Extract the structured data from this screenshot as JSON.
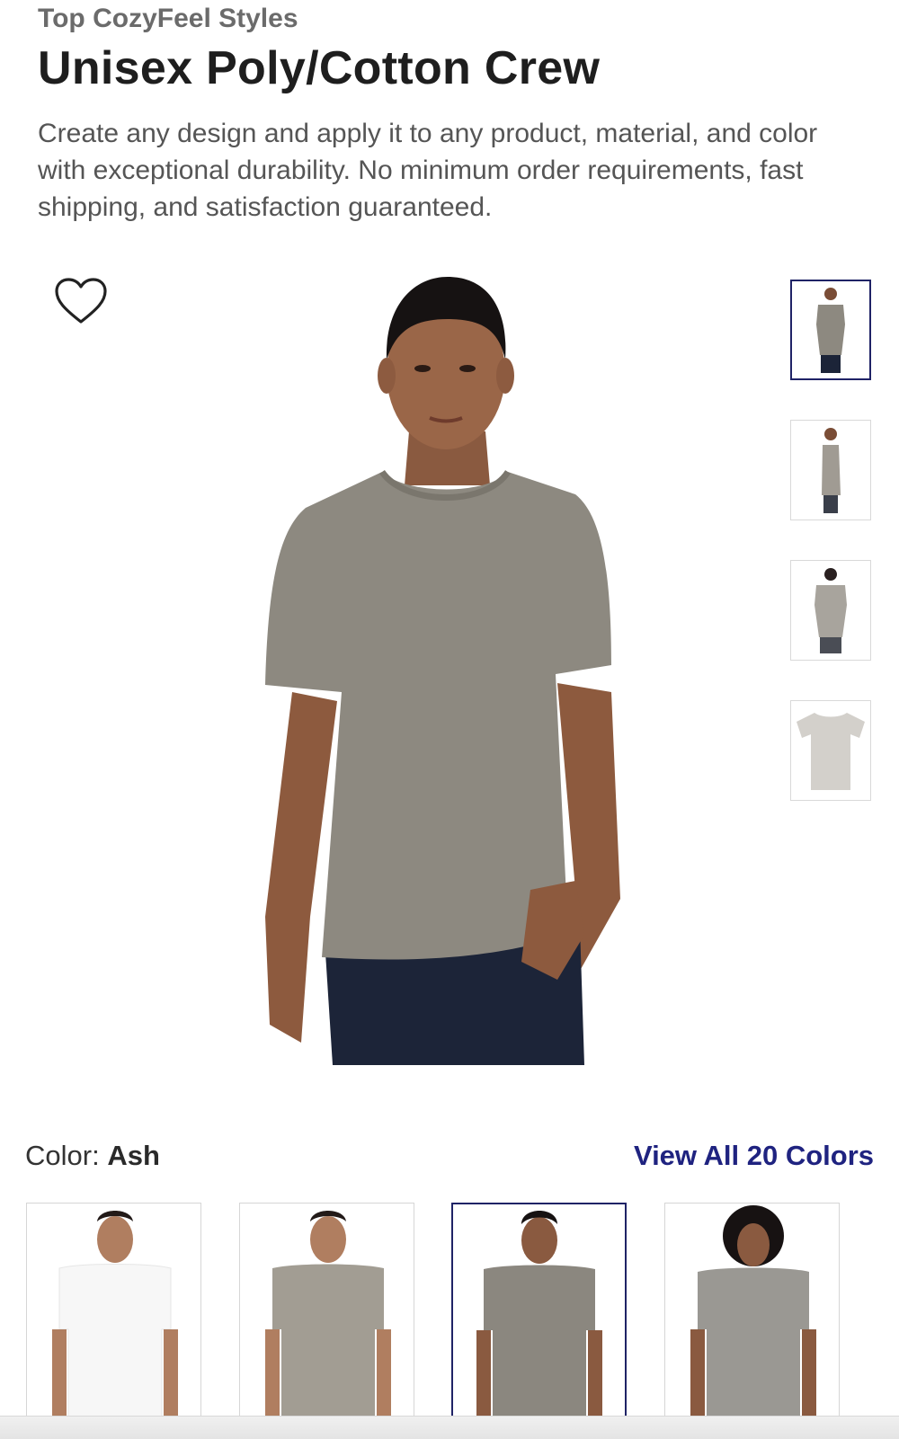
{
  "header": {
    "eyebrow": "Top CozyFeel Styles",
    "title": "Unisex Poly/Cotton Crew",
    "description": "Create any design and apply it to any product, material, and color with exceptional durability. No minimum order requirements, fast shipping, and satisfaction guaranteed."
  },
  "favorite": {
    "icon": "heart-outline-icon"
  },
  "gallery": {
    "main_view": "front",
    "thumbnails": [
      {
        "view": "front",
        "active": true
      },
      {
        "view": "side",
        "active": false
      },
      {
        "view": "back",
        "active": false
      },
      {
        "view": "flat",
        "active": false
      }
    ]
  },
  "color": {
    "label": "Color:",
    "selected": "Ash",
    "view_all": "View All 20 Colors",
    "swatches": [
      {
        "shirt_color": "#f7f7f7",
        "active": false
      },
      {
        "shirt_color": "#a29d93",
        "active": false
      },
      {
        "shirt_color": "#8b877f",
        "active": true
      },
      {
        "shirt_color": "#9a9893",
        "active": false
      }
    ]
  },
  "colors": {
    "accent": "#1f2380",
    "shirt_ash": "#8d8980",
    "jeans": "#1c2438"
  }
}
